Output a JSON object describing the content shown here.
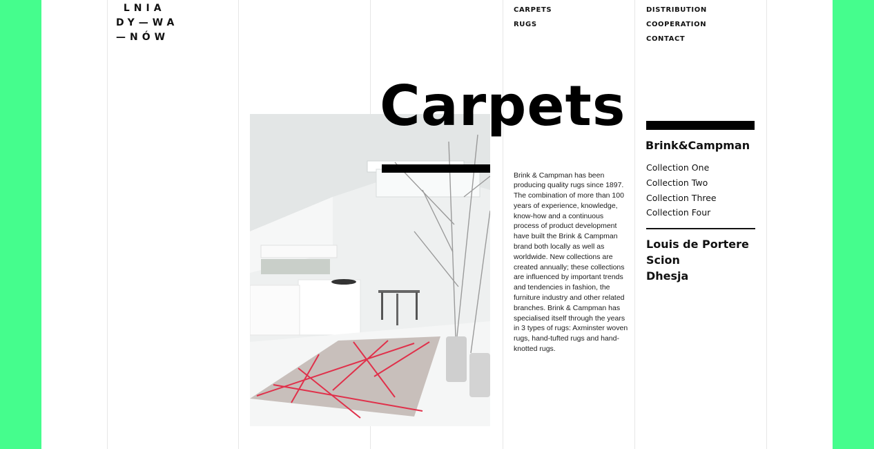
{
  "logo": {
    "line1": " LNIA",
    "line2": "DY—WA",
    "line3": "—NÓW"
  },
  "nav": {
    "col1": [
      "CARPETS",
      "RUGS"
    ],
    "col2": [
      "DISTRIBUTION",
      "COOPERATION",
      "CONTACT"
    ]
  },
  "main": {
    "title": "Carpets",
    "body": "Brink & Campman has been producing quality rugs since 1897. The combination of more than 100 years of experience, knowledge, know-how and a continuous process of product development have built the Brink & Campman brand both locally as well as worldwide. New collections are created annually; these collections are influenced by important trends and tendencies in fashion, the furniture industry and other related branches. Brink & Campman has specialised itself through the years in 3 types of rugs: Axminster woven rugs, hand-tufted rugs and hand-knotted rugs."
  },
  "sidebar": {
    "brand_title": "Brink&Campman",
    "collections": [
      "Collection One",
      "Collection Two",
      "Collection Three",
      "Collection Four"
    ],
    "brands": [
      "Louis de Portere",
      "Scion",
      "Dhesja"
    ]
  },
  "colors": {
    "background": "#45fd8d",
    "page": "#ffffff",
    "text": "#111111",
    "carpet_line": "#e0304a"
  }
}
